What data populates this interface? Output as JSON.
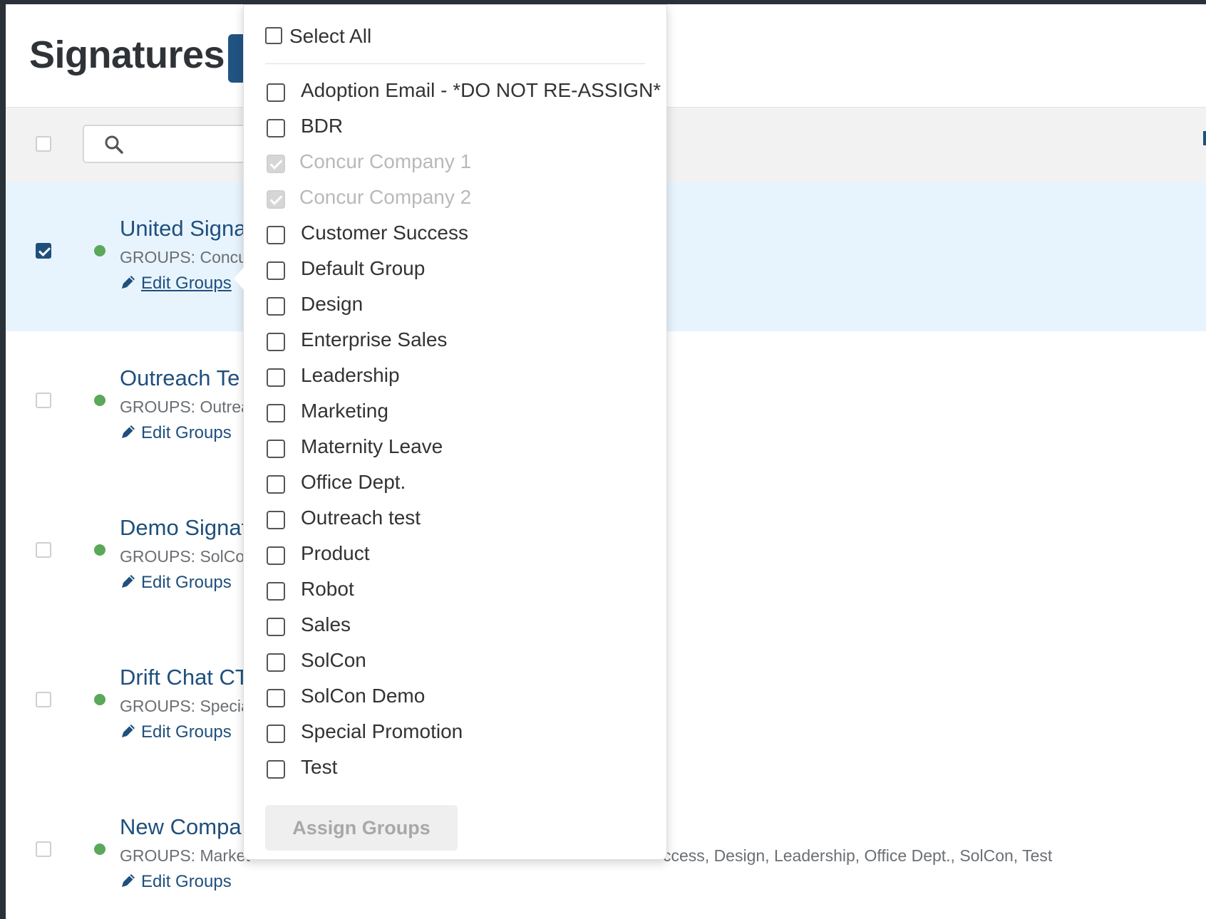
{
  "header": {
    "title": "Signatures"
  },
  "toolbar": {
    "search_placeholder": ""
  },
  "rows": [
    {
      "name": "United Signa",
      "groups": "GROUPS: Concu",
      "edit_label": "Edit Groups",
      "checked": true
    },
    {
      "name": "Outreach Te",
      "groups": "GROUPS: Outrea",
      "edit_label": "Edit Groups",
      "checked": false
    },
    {
      "name": "Demo Signat",
      "groups": "GROUPS: SolCon",
      "edit_label": "Edit Groups",
      "checked": false
    },
    {
      "name": "Drift Chat CT",
      "groups": "GROUPS: Specia",
      "edit_label": "Edit Groups",
      "checked": false
    },
    {
      "name": "New Compa",
      "groups": "GROUPS: Market",
      "groups_tail": "ccess, Design, Leadership, Office Dept., SolCon, Test",
      "edit_label": "Edit Groups",
      "checked": false
    }
  ],
  "popover": {
    "select_all_label": "Select All",
    "options": [
      {
        "label": "Adoption Email - *DO NOT RE-ASSIGN*",
        "state": "unchecked"
      },
      {
        "label": "BDR",
        "state": "unchecked"
      },
      {
        "label": "Concur Company 1",
        "state": "checked-disabled"
      },
      {
        "label": "Concur Company 2",
        "state": "checked-disabled"
      },
      {
        "label": "Customer Success",
        "state": "unchecked"
      },
      {
        "label": "Default Group",
        "state": "unchecked"
      },
      {
        "label": "Design",
        "state": "unchecked"
      },
      {
        "label": "Enterprise Sales",
        "state": "unchecked"
      },
      {
        "label": "Leadership",
        "state": "unchecked"
      },
      {
        "label": "Marketing",
        "state": "unchecked"
      },
      {
        "label": "Maternity Leave",
        "state": "unchecked"
      },
      {
        "label": "Office Dept.",
        "state": "unchecked"
      },
      {
        "label": "Outreach test",
        "state": "unchecked"
      },
      {
        "label": "Product",
        "state": "unchecked"
      },
      {
        "label": "Robot",
        "state": "unchecked"
      },
      {
        "label": "Sales",
        "state": "unchecked"
      },
      {
        "label": "SolCon",
        "state": "unchecked"
      },
      {
        "label": "SolCon Demo",
        "state": "unchecked"
      },
      {
        "label": "Special Promotion",
        "state": "unchecked"
      },
      {
        "label": "Test",
        "state": "unchecked"
      }
    ],
    "assign_label": "Assign Groups"
  },
  "colors": {
    "brand": "#1f4f7d",
    "status_active": "#5aa85a",
    "selected_row": "#e8f4fd"
  }
}
